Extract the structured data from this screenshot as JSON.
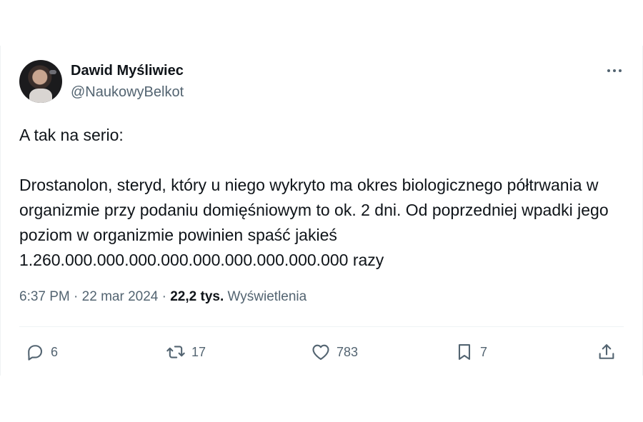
{
  "tweet": {
    "display_name": "Dawid Myśliwiec",
    "handle": "@NaukowyBelkot",
    "paragraphs": [
      "A tak na serio:",
      "Drostanolon, steryd, który u niego wykryto ma okres biologicznego półtrwania w organizmie przy podaniu domięśniowym to ok. 2 dni. Od poprzedniej wpadki jego poziom w organizmie powinien spaść jakieś 1.260.000.000.000.000.000.000.000.000.000 razy"
    ],
    "time": "6:37 PM",
    "date": "22 mar 2024",
    "separator": "·",
    "views_count": "22,2 tys.",
    "views_label": "Wyświetlenia"
  },
  "actions": {
    "reply_count": "6",
    "retweet_count": "17",
    "like_count": "783",
    "bookmark_count": "7"
  },
  "colors": {
    "text_primary": "#0f1419",
    "text_secondary": "#536471",
    "divider": "#eff3f4"
  },
  "icons": [
    "more-icon",
    "reply-icon",
    "retweet-icon",
    "like-icon",
    "bookmark-icon",
    "share-icon"
  ]
}
